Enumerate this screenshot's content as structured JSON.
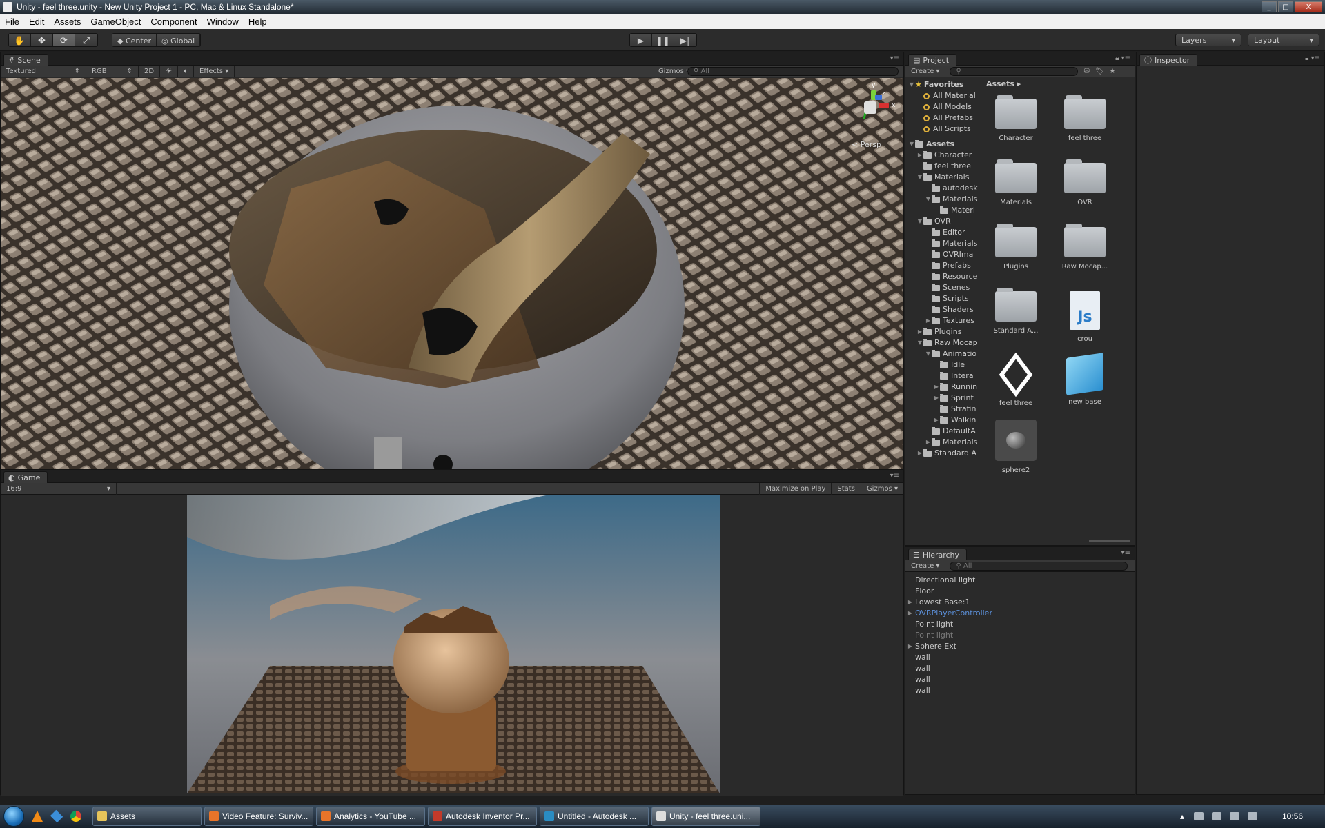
{
  "window": {
    "title": "Unity - feel three.unity - New Unity Project 1 - PC, Mac & Linux Standalone*",
    "minimize": "_",
    "maximize": "□",
    "close": "X"
  },
  "menu": [
    "File",
    "Edit",
    "Assets",
    "GameObject",
    "Component",
    "Window",
    "Help"
  ],
  "toolbar": {
    "tools": [
      {
        "name": "hand-tool",
        "glyph": "✋"
      },
      {
        "name": "move-tool",
        "glyph": "✥"
      },
      {
        "name": "rotate-tool",
        "glyph": "⟳"
      },
      {
        "name": "scale-tool",
        "glyph": "⤢"
      }
    ],
    "pivot": "Center",
    "space": "Global",
    "play": "▶",
    "pause": "❚❚",
    "step": "▶|",
    "layers": "Layers",
    "layout": "Layout"
  },
  "scene": {
    "tab": "Scene",
    "shading": "Textured",
    "render_mode": "RGB",
    "mode_2d": "2D",
    "effects": "Effects",
    "gizmos": "Gizmos",
    "search_placeholder": "All",
    "persp_label": "< Persp",
    "axis_y": "y",
    "axis_z": "z",
    "axis_x": "x"
  },
  "game": {
    "tab": "Game",
    "aspect": "16:9",
    "maximize_on_play": "Maximize on Play",
    "stats": "Stats",
    "gizmos": "Gizmos"
  },
  "project": {
    "tab": "Project",
    "create": "Create",
    "breadcrumb": "Assets",
    "favorites_label": "Favorites",
    "favorites": [
      "All Material",
      "All Models",
      "All Prefabs",
      "All Scripts"
    ],
    "tree": [
      {
        "label": "Assets",
        "depth": 0,
        "fold": "▼",
        "bold": true
      },
      {
        "label": "Character",
        "depth": 1,
        "fold": "▶"
      },
      {
        "label": "feel three",
        "depth": 1,
        "fold": ""
      },
      {
        "label": "Materials",
        "depth": 1,
        "fold": "▼"
      },
      {
        "label": "autodesk",
        "depth": 2,
        "fold": ""
      },
      {
        "label": "Materials",
        "depth": 2,
        "fold": "▼"
      },
      {
        "label": "Materi",
        "depth": 3,
        "fold": ""
      },
      {
        "label": "OVR",
        "depth": 1,
        "fold": "▼"
      },
      {
        "label": "Editor",
        "depth": 2,
        "fold": ""
      },
      {
        "label": "Materials",
        "depth": 2,
        "fold": ""
      },
      {
        "label": "OVRIma",
        "depth": 2,
        "fold": ""
      },
      {
        "label": "Prefabs",
        "depth": 2,
        "fold": ""
      },
      {
        "label": "Resource",
        "depth": 2,
        "fold": ""
      },
      {
        "label": "Scenes",
        "depth": 2,
        "fold": ""
      },
      {
        "label": "Scripts",
        "depth": 2,
        "fold": ""
      },
      {
        "label": "Shaders",
        "depth": 2,
        "fold": ""
      },
      {
        "label": "Textures",
        "depth": 2,
        "fold": "▶"
      },
      {
        "label": "Plugins",
        "depth": 1,
        "fold": "▶"
      },
      {
        "label": "Raw Mocap",
        "depth": 1,
        "fold": "▼"
      },
      {
        "label": "Animatio",
        "depth": 2,
        "fold": "▼"
      },
      {
        "label": "Idle",
        "depth": 3,
        "fold": ""
      },
      {
        "label": "Intera",
        "depth": 3,
        "fold": ""
      },
      {
        "label": "Runnin",
        "depth": 3,
        "fold": "▶"
      },
      {
        "label": "Sprint",
        "depth": 3,
        "fold": "▶"
      },
      {
        "label": "Strafin",
        "depth": 3,
        "fold": ""
      },
      {
        "label": "Walkin",
        "depth": 3,
        "fold": "▶"
      },
      {
        "label": "DefaultA",
        "depth": 2,
        "fold": ""
      },
      {
        "label": "Materials",
        "depth": 2,
        "fold": "▶"
      },
      {
        "label": "Standard A",
        "depth": 1,
        "fold": "▶"
      }
    ],
    "assets": [
      {
        "label": "Character",
        "kind": "folder"
      },
      {
        "label": "feel three",
        "kind": "folder"
      },
      {
        "label": "Materials",
        "kind": "folder"
      },
      {
        "label": "OVR",
        "kind": "folder"
      },
      {
        "label": "Plugins",
        "kind": "folder"
      },
      {
        "label": "Raw Mocap...",
        "kind": "folder"
      },
      {
        "label": "Standard A...",
        "kind": "folder"
      },
      {
        "label": "crou",
        "kind": "script",
        "glyph": "Js"
      },
      {
        "label": "feel three",
        "kind": "unity"
      },
      {
        "label": "new base",
        "kind": "prefab"
      },
      {
        "label": "sphere2",
        "kind": "model"
      }
    ]
  },
  "inspector": {
    "tab": "Inspector"
  },
  "hierarchy": {
    "tab": "Hierarchy",
    "create": "Create",
    "search_placeholder": "All",
    "items": [
      {
        "label": "Directional light",
        "fold": "",
        "style": "normal"
      },
      {
        "label": "Floor",
        "fold": "",
        "style": "normal"
      },
      {
        "label": "Lowest Base:1",
        "fold": "▶",
        "style": "normal"
      },
      {
        "label": "OVRPlayerController",
        "fold": "▶",
        "style": "prefab"
      },
      {
        "label": "Point light",
        "fold": "",
        "style": "normal"
      },
      {
        "label": "Point light",
        "fold": "",
        "style": "disabled"
      },
      {
        "label": "Sphere Ext",
        "fold": "▶",
        "style": "normal"
      },
      {
        "label": "wall",
        "fold": "",
        "style": "normal"
      },
      {
        "label": "wall",
        "fold": "",
        "style": "normal"
      },
      {
        "label": "wall",
        "fold": "",
        "style": "normal"
      },
      {
        "label": "wall",
        "fold": "",
        "style": "normal"
      }
    ]
  },
  "taskbar": {
    "tasks": [
      {
        "label": "Assets",
        "icon": "folder-icon",
        "color": "#e6c45a",
        "active": false
      },
      {
        "label": "Video Feature: Surviv...",
        "icon": "firefox-icon",
        "color": "#e8742a",
        "active": false
      },
      {
        "label": "Analytics - YouTube ...",
        "icon": "firefox-icon",
        "color": "#e8742a",
        "active": false
      },
      {
        "label": "Autodesk Inventor Pr...",
        "icon": "inventor-icon",
        "color": "#c23a2a",
        "active": false
      },
      {
        "label": "Untitled - Autodesk ...",
        "icon": "autodesk-icon",
        "color": "#2a8cc2",
        "active": false
      },
      {
        "label": "Unity - feel three.uni...",
        "icon": "unity-icon",
        "color": "#dddddd",
        "active": true
      }
    ],
    "clock": "10:56"
  },
  "colors": {
    "editor_bg": "#2a2a2a",
    "prefab_text": "#5b8fd8",
    "disabled_text": "#7a7a7a",
    "favorites_star": "#e8c23a"
  }
}
